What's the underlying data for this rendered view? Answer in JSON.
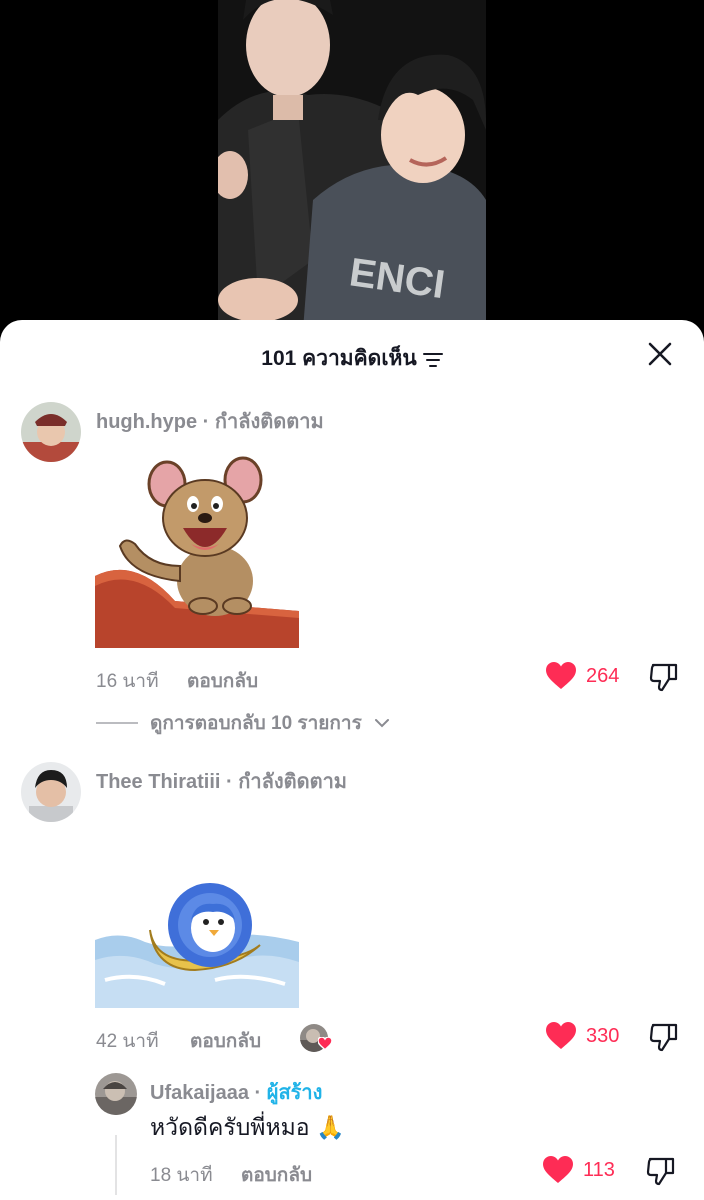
{
  "header": {
    "comment_count_title": "101 ความคิดเห็น"
  },
  "comments": [
    {
      "username": "hugh.hype",
      "follow_status": "กำลังติดตาม",
      "time": "16 นาที",
      "reply_label": "ตอบกลับ",
      "likes": "264",
      "view_replies": "ดูการตอบกลับ 10 รายการ"
    },
    {
      "username": "Thee Thiratiii",
      "follow_status": "กำลังติดตาม",
      "time": "42 นาที",
      "reply_label": "ตอบกลับ",
      "likes": "330"
    }
  ],
  "reply": {
    "username": "Ufakaijaaa",
    "badge": "ผู้สร้าง",
    "text": "หวัดดีครับพี่หมอ 🙏",
    "time": "18 นาที",
    "reply_label": "ตอบกลับ",
    "likes": "113"
  },
  "colors": {
    "like": "#fe2c55",
    "creator_badge": "#20b3e8",
    "muted_text": "#8a8b91"
  },
  "icons": [
    "filter-icon",
    "close-icon",
    "heart-icon",
    "dislike-icon",
    "chevron-down-icon"
  ]
}
